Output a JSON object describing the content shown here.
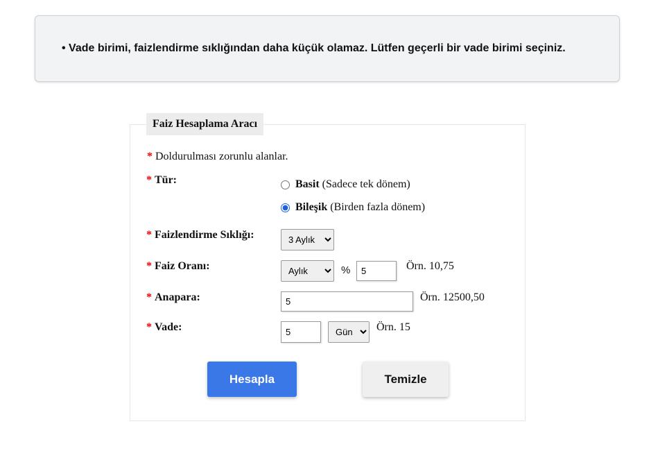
{
  "alert": {
    "message": "• Vade birimi, faizlendirme sıklığından daha küçük olamaz. Lütfen geçerli bir vade birimi seçiniz."
  },
  "form": {
    "title": "Faiz Hesaplama Aracı",
    "required_star": "*",
    "required_note": "Doldurulması zorunlu alanlar.",
    "type": {
      "label": "Tür:",
      "options": [
        {
          "name": "Basit",
          "desc": "(Sadece tek dönem)",
          "checked": false
        },
        {
          "name": "Bileşik",
          "desc": "(Birden fazla dönem)",
          "checked": true
        }
      ]
    },
    "frequency": {
      "label": "Faizlendirme Sıklığı:",
      "selected": "3 Aylık"
    },
    "rate": {
      "label": "Faiz Oranı:",
      "period_selected": "Aylık",
      "percent_sign": "%",
      "value": "5",
      "hint": "Örn. 10,75"
    },
    "principal": {
      "label": "Anapara:",
      "value": "5",
      "hint": "Örn. 12500,50"
    },
    "term": {
      "label": "Vade:",
      "value": "5",
      "unit_selected": "Gün",
      "hint": "Örn. 15"
    },
    "calculate_label": "Hesapla",
    "clear_label": "Temizle",
    "colors": {
      "primary": "#3b78e7",
      "required": "#ee0000"
    }
  }
}
